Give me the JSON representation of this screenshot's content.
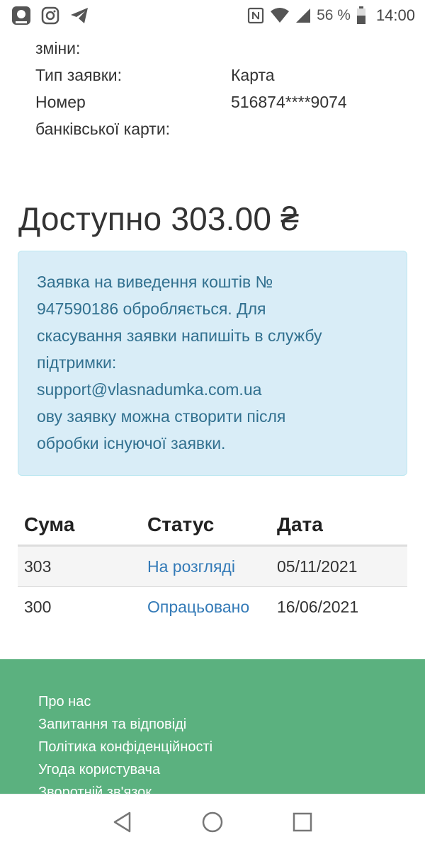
{
  "status_bar": {
    "battery_percent": "56 %",
    "time": "14:00",
    "icons": [
      "app-icon",
      "instagram-icon",
      "telegram-icon",
      "nfc-icon",
      "wifi-icon",
      "signal-icon",
      "battery-icon"
    ]
  },
  "details": {
    "change_label_tail": "зміни:",
    "type_label": "Тип заявки:",
    "type_value": "Карта",
    "card_label_line1": "Номер",
    "card_label_line2": "банківської карти:",
    "card_value": "516874****9074"
  },
  "balance": {
    "available_text": "Доступно 303.00 ₴"
  },
  "alert": {
    "line1": "Заявка на виведення коштів №",
    "line2": "947590186 обробляється. Для",
    "line3": "скасування заявки напишіть в службу",
    "line4": "підтримки:",
    "line5": "support@vlasnadumka.com.ua",
    "line6": "ову заявку можна створити після",
    "line7": "обробки існуючої заявки."
  },
  "table": {
    "headers": {
      "sum": "Сума",
      "status": "Статус",
      "date": "Дата"
    },
    "rows": [
      {
        "sum": "303",
        "status": "На розгляді",
        "date": "05/11/2021"
      },
      {
        "sum": "300",
        "status": "Опрацьовано",
        "date": "16/06/2021"
      }
    ]
  },
  "footer": {
    "links": [
      "Про нас",
      "Запитання та відповіді",
      "Політика конфіденційності",
      "Угода користувача",
      "Зворотній зв'язок"
    ]
  },
  "colors": {
    "alert_bg": "#d9edf7",
    "alert_text": "#31708f",
    "link": "#337ab7",
    "footer_bg": "#5bb17f"
  }
}
